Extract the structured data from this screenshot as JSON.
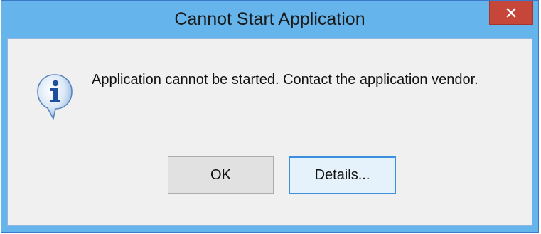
{
  "window": {
    "title": "Cannot Start Application",
    "close_label": "×"
  },
  "dialog": {
    "icon": "info-icon",
    "message": "Application cannot be started. Contact the application vendor."
  },
  "buttons": {
    "ok_label": "OK",
    "details_label": "Details..."
  },
  "colors": {
    "titlebar": "#65b4ec",
    "close_button": "#c7463a",
    "client_background": "#f0f0f0",
    "focus_border": "#3c8fdc"
  }
}
